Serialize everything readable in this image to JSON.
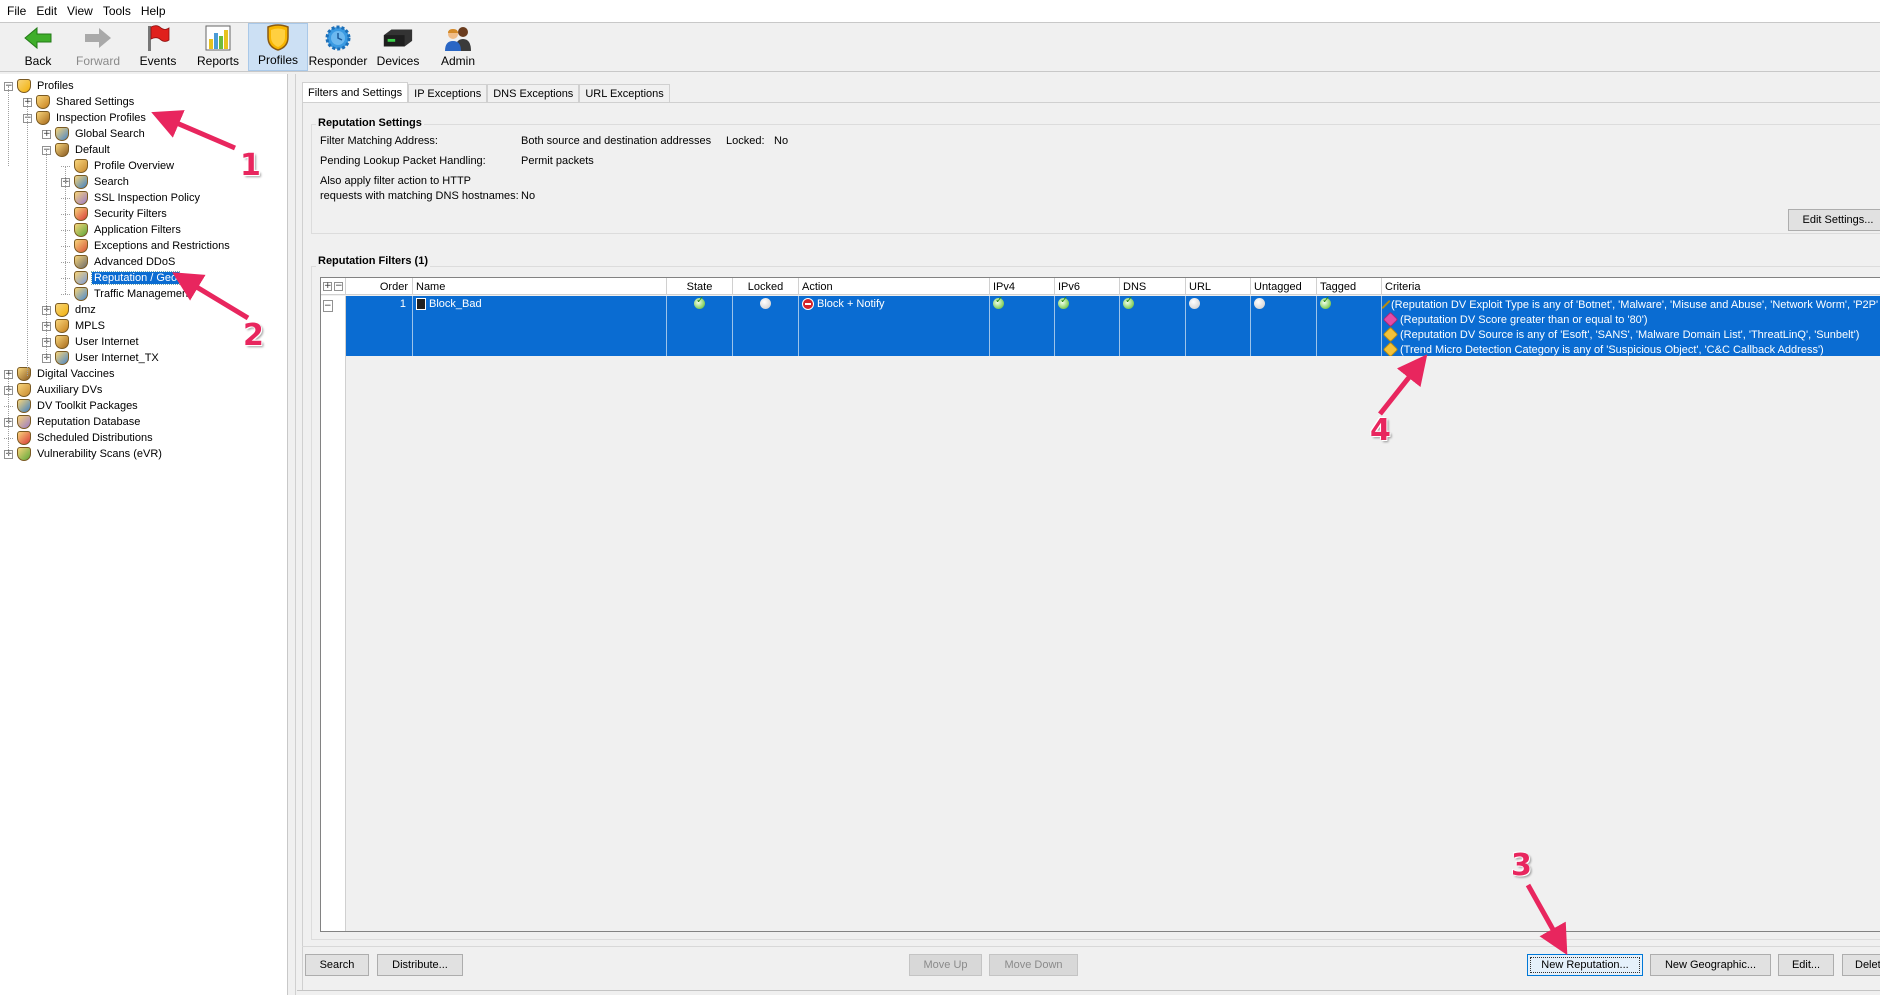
{
  "menu": [
    "File",
    "Edit",
    "View",
    "Tools",
    "Help"
  ],
  "toolbar": [
    {
      "label": "Back",
      "icon": "back-arrow-icon",
      "state": "enabled"
    },
    {
      "label": "Forward",
      "icon": "forward-arrow-icon",
      "state": "disabled"
    },
    {
      "label": "Events",
      "icon": "events-flag-icon",
      "state": "enabled"
    },
    {
      "label": "Reports",
      "icon": "reports-chart-icon",
      "state": "enabled"
    },
    {
      "label": "Profiles",
      "icon": "profiles-shield-icon",
      "state": "active"
    },
    {
      "label": "Responder",
      "icon": "responder-gear-icon",
      "state": "enabled"
    },
    {
      "label": "Devices",
      "icon": "devices-appliance-icon",
      "state": "enabled"
    },
    {
      "label": "Admin",
      "icon": "admin-users-icon",
      "state": "enabled"
    }
  ],
  "tree": {
    "items": [
      {
        "label": "Profiles",
        "level": 0,
        "expander": "minus"
      },
      {
        "label": "Shared Settings",
        "level": 1,
        "expander": "plus"
      },
      {
        "label": "Inspection Profiles",
        "level": 1,
        "expander": "minus"
      },
      {
        "label": "Global Search",
        "level": 2,
        "expander": "plus"
      },
      {
        "label": "Default",
        "level": 2,
        "expander": "minus"
      },
      {
        "label": "Profile Overview",
        "level": 3,
        "expander": "none"
      },
      {
        "label": "Search",
        "level": 3,
        "expander": "plus"
      },
      {
        "label": "SSL Inspection Policy",
        "level": 3,
        "expander": "none"
      },
      {
        "label": "Security Filters",
        "level": 3,
        "expander": "none"
      },
      {
        "label": "Application Filters",
        "level": 3,
        "expander": "none"
      },
      {
        "label": "Exceptions and Restrictions",
        "level": 3,
        "expander": "none"
      },
      {
        "label": "Advanced DDoS",
        "level": 3,
        "expander": "none"
      },
      {
        "label": "Reputation / Geo",
        "level": 3,
        "expander": "none",
        "selected": true
      },
      {
        "label": "Traffic Management",
        "level": 3,
        "expander": "none"
      },
      {
        "label": "dmz",
        "level": 2,
        "expander": "plus"
      },
      {
        "label": "MPLS",
        "level": 2,
        "expander": "plus"
      },
      {
        "label": "User Internet",
        "level": 2,
        "expander": "plus"
      },
      {
        "label": "User Internet_TX",
        "level": 2,
        "expander": "plus"
      },
      {
        "label": "Digital Vaccines",
        "level": 0,
        "expander": "plus"
      },
      {
        "label": "Auxiliary DVs",
        "level": 0,
        "expander": "plus"
      },
      {
        "label": "DV Toolkit Packages",
        "level": 0,
        "expander": "none"
      },
      {
        "label": "Reputation Database",
        "level": 0,
        "expander": "plus"
      },
      {
        "label": "Scheduled Distributions",
        "level": 0,
        "expander": "none"
      },
      {
        "label": "Vulnerability Scans (eVR)",
        "level": 0,
        "expander": "plus"
      }
    ]
  },
  "tabs": [
    "Filters and Settings",
    "IP Exceptions",
    "DNS Exceptions",
    "URL Exceptions"
  ],
  "active_tab": "Filters and Settings",
  "reputation_settings": {
    "title": "Reputation Settings",
    "filter_matching_label": "Filter Matching Address:",
    "filter_matching_value": "Both source and destination addresses",
    "locked_label": "Locked:",
    "locked_value": "No",
    "pending_label": "Pending Lookup Packet Handling:",
    "pending_value": "Permit packets",
    "http_label_1": "Also apply filter action to HTTP",
    "http_label_2": "requests with matching DNS hostnames:",
    "http_value": "No",
    "edit_button": "Edit Settings..."
  },
  "filters": {
    "title": "Reputation Filters (1)",
    "columns": [
      "Order",
      "Name",
      "State",
      "Locked",
      "Action",
      "IPv4",
      "IPv6",
      "DNS",
      "URL",
      "Untagged",
      "Tagged",
      "Criteria"
    ],
    "rows": [
      {
        "order": "1",
        "name": "Block_Bad",
        "state": true,
        "locked": false,
        "action": "Block + Notify",
        "ipv4": true,
        "ipv6": true,
        "dns": true,
        "url": false,
        "untagged": false,
        "tagged": true,
        "criteria": [
          {
            "text": "(Reputation DV Exploit Type is any of 'Botnet', 'Malware', 'Misuse and Abuse', 'Network Worm', 'P2P'",
            "tag_color": "#f2c23a"
          },
          {
            "text": "(Reputation DV Score greater than or equal to '80')",
            "tag_color": "#e24ca7"
          },
          {
            "text": "(Reputation DV Source is any of 'Esoft', 'SANS', 'Malware Domain List', 'ThreatLinQ', 'Sunbelt')",
            "tag_color": "#f2c23a"
          },
          {
            "text": "(Trend Micro Detection Category is any of 'Suspicious Object', 'C&C Callback Address')",
            "tag_color": "#f2c23a"
          }
        ]
      }
    ]
  },
  "bottom_buttons": {
    "search": "Search",
    "distribute": "Distribute...",
    "move_up": "Move Up",
    "move_down": "Move Down",
    "new_reputation": "New Reputation...",
    "new_geographic": "New Geographic...",
    "edit": "Edit...",
    "delete": "Delete"
  },
  "annotations": [
    "1",
    "2",
    "3",
    "4"
  ],
  "colors": {
    "selection": "#0a6cd2",
    "annotation": "#e8265e",
    "active_toolbar": "#cce0f4"
  }
}
